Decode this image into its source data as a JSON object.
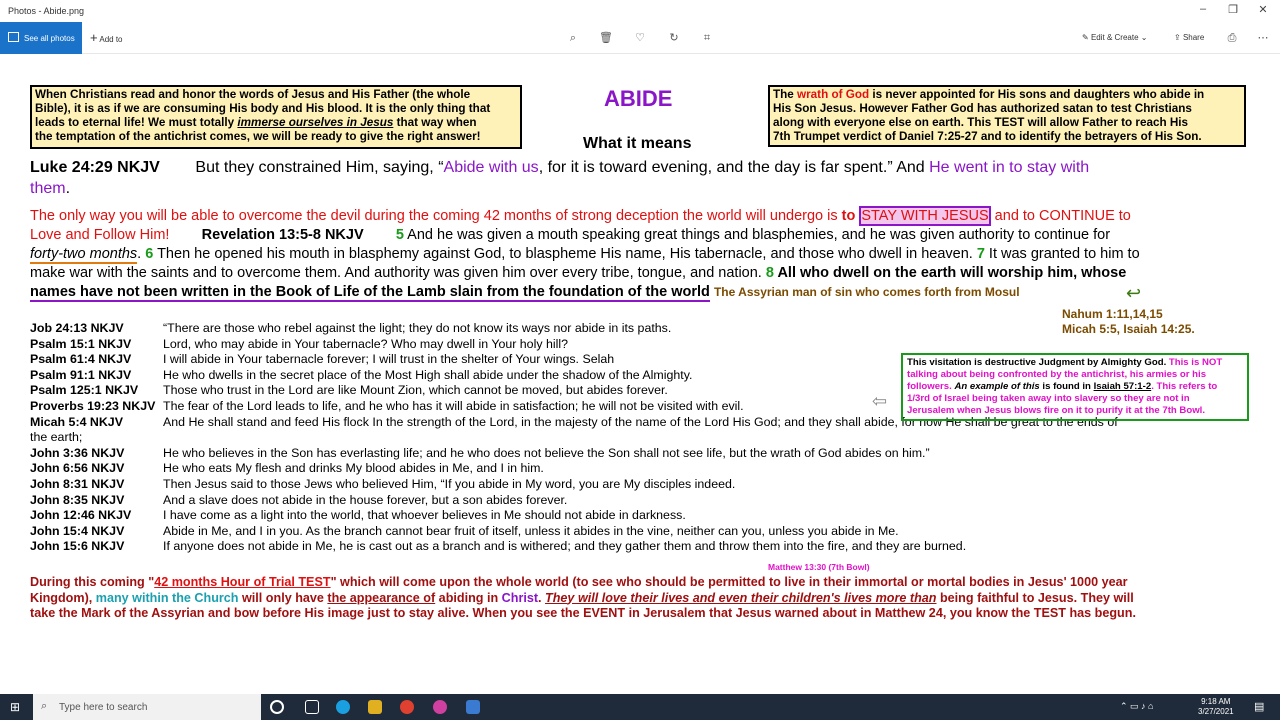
{
  "window": {
    "title": "Photos - Abide.png",
    "min": "–",
    "max": "❐",
    "close": "✕"
  },
  "toolbar": {
    "see_all": "See all photos",
    "add_to": "Add to",
    "edit_create": "Edit & Create",
    "share": "Share"
  },
  "doc": {
    "top_left_box": [
      "When Christians read and honor the words of Jesus and His Father (the whole",
      "Bible), it is as if we are consuming His body and His blood. It is the only thing that",
      "leads to eternal life! We must totally ",
      "immerse ourselves in Jesus",
      " that way when",
      "the temptation of the antichrist comes, we will be ready to give the right answer!"
    ],
    "title": "ABIDE",
    "subtitle": "What it means",
    "top_right_box": [
      "The ",
      "wrath of God",
      " is never appointed for His sons and daughters who abide in",
      "His Son Jesus. However Father God has authorized satan to test Christians",
      "along with everyone else on earth. This ",
      "TEST",
      " will allow Father to reach His",
      "7th Trumpet verdict of Daniel 7:25-27 and to identify the betrayers of His Son."
    ],
    "luke": {
      "ref": "Luke 24:29 NKJV",
      "a": "But they constrained Him, saying, “",
      "b": "Abide with us",
      ",": ", for it is toward evening, and the day is far spent.” And ",
      "c": "He went in to stay with",
      "d": "them",
      "e": "."
    },
    "p2": {
      "a": "The only way you will be able to overcome the devil during the coming 42 months of strong deception the world will undergo is ",
      "b": "to ",
      "c": "STAY WITH JESUS",
      "d": " and to CONTINUE to",
      "e": "Love and Follow Him!",
      "f": "Revelation 13:5-8 NKJV",
      "g": "5",
      "h": " And he was given a mouth speaking great things and blasphemies, and he was given authority to continue for",
      "i": "forty-two months",
      "j": ". ",
      "k": "6",
      "l": " Then he opened his mouth in blasphemy against God, to blaspheme His name, His tabernacle, and those who dwell in heaven. ",
      "m": "7",
      "n": " It was granted to him to",
      "o": "make war with the saints and to overcome them. And authority was given him over every tribe, tongue, and nation. ",
      "p": "8",
      "q": " All who dwell on the earth will worship him, whose",
      "r": "names have not been written in the Book of Life of the Lamb slain from the foundation of the world",
      ".": ".",
      "s": "The Assyrian man of sin who comes forth from Mosul",
      "t": "Nahum 1:11,14,15",
      "u": "Micah 5:5, Isaiah 14:25."
    },
    "verses": [
      {
        "ref": "Job 24:13 NKJV",
        "text": "“There are those who rebel against the light; they do not know its ways nor abide in its paths."
      },
      {
        "ref": "Psalm 15:1 NKJV",
        "text": "Lord, who may abide in Your tabernacle? Who may dwell in Your holy hill?"
      },
      {
        "ref": "Psalm 61:4 NKJV",
        "text": "I will abide in Your tabernacle forever; I will trust in the shelter of Your wings. Selah"
      },
      {
        "ref": "Psalm 91:1 NKJV",
        "text": "He who dwells in the secret place of the Most High shall abide under the shadow of the Almighty."
      },
      {
        "ref": "Psalm 125:1 NKJV",
        "text": "Those who trust in the Lord are like Mount Zion, which cannot be moved, but abides forever."
      },
      {
        "ref": "Proverbs 19:23 NKJV",
        "text": "The fear of the Lord leads to life, and he who has it will abide in satisfaction; he will not be visited with evil."
      },
      {
        "ref": "Micah 5:4 NKJV",
        "text": "And He shall stand and feed His flock In the strength of the Lord, in the majesty of the name of the Lord His God; and they shall abide, for now He shall be great to the ends of"
      },
      {
        "ref": "",
        "text": "the earth;"
      },
      {
        "ref": "John 3:36 NKJV",
        "text": "He who believes in the Son has everlasting life; and he who does not believe the Son shall not see life, but the wrath of God abides on him.”"
      },
      {
        "ref": "John 6:56 NKJV",
        "text": "He who eats My flesh and drinks My blood abides in Me, and I in him."
      },
      {
        "ref": "John 8:31 NKJV",
        "text": "Then Jesus said to those Jews who believed Him, “If you abide in My word, you are My disciples indeed."
      },
      {
        "ref": "John 8:35 NKJV",
        "text": "And a slave does not abide in the house forever, but a son abides forever."
      },
      {
        "ref": "John 12:46 NKJV",
        "text": "I have come as a light into the world, that whoever believes in Me should not abide in darkness."
      },
      {
        "ref": "John 15:4 NKJV",
        "text": "Abide in Me, and I in you. As the branch cannot bear fruit of itself, unless it abides in the vine, neither can you, unless you abide in Me."
      },
      {
        "ref": "John 15:6  NKJV",
        "text": "If anyone does not abide in Me, he is cast out as a branch and is withered; and they gather them and throw them into the fire, and they are burned."
      }
    ],
    "green_box": [
      "This visitation is destructive Judgment by Almighty God. ",
      "This is NOT",
      "talking about being confronted by the antichrist, his armies or his",
      "followers. ",
      "An example of this",
      " is found in ",
      "Isaiah 57:1-2",
      ". This refers to",
      "1/3rd of Israel being taken away into slavery so they are not in",
      "Jerusalem when Jesus blows fire on it to purify it at the 7th Bowl."
    ],
    "matthew_note": "Matthew 13:30 (7th Bowl)",
    "bottom": [
      "During this coming \"",
      "42 months Hour of Trial TEST",
      "\" which will come upon the whole world (to see who should be permitted to live in their immortal or mortal bodies in Jesus' 1000 year",
      "Kingdom), ",
      "many within the Church",
      " will only have ",
      "the appearance of",
      " abiding in ",
      "Christ",
      ". ",
      "They will love their lives and even their children's lives more than",
      " being faithful to Jesus. They will",
      "take the Mark of the Assyrian and bow before His image just to stay alive. When you see the EVENT in Jerusalem that Jesus warned about in Matthew 24, you know the TEST has begun."
    ]
  },
  "taskbar": {
    "search_placeholder": "Type here to search",
    "time": "9:18 AM",
    "date": "3/27/2021"
  }
}
